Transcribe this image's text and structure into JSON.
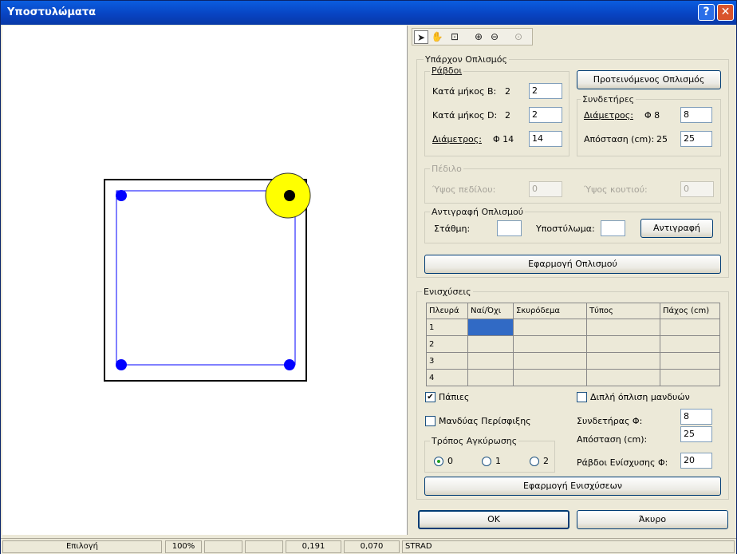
{
  "window": {
    "title": "Υποστυλώματα"
  },
  "toolbar": {
    "tools": [
      "pointer-icon",
      "hand-pan-icon",
      "zoom-window-icon",
      "zoom-in-icon",
      "zoom-out-icon",
      "zoom-extents-icon"
    ]
  },
  "existing": {
    "legend": "Υπάρχον Οπλισμός",
    "bars": {
      "legend": "Ράβδοι",
      "len_b_label": "Κατά μήκος B:",
      "len_b_value": "2",
      "len_b_input": "2",
      "len_d_label": "Κατά μήκος D:",
      "len_d_value": "2",
      "len_d_input": "2",
      "diam_label": "Διάμετρος:",
      "diam_value": "Φ 14",
      "diam_input": "14"
    },
    "suggested_button": "Προτεινόμενος Οπλισμός",
    "stirrups": {
      "legend": "Συνδετήρες",
      "diam_label": "Διάμετρος:",
      "diam_value": "Φ 8",
      "diam_input": "8",
      "spacing_label": "Απόσταση (cm):",
      "spacing_value": "25",
      "spacing_input": "25"
    },
    "footing": {
      "legend": "Πέδιλο",
      "height_label": "Ύψος πεδίλου:",
      "height_input": "0",
      "box_label": "Ύψος κουτιού:",
      "box_input": "0"
    },
    "copy": {
      "legend": "Αντιγραφή Οπλισμού",
      "level_label": "Στάθμη:",
      "level_input": "",
      "column_label": "Υποστύλωμα:",
      "column_input": "",
      "copy_button": "Αντιγραφή"
    },
    "apply_button": "Εφαρμογή Οπλισμού"
  },
  "reinforcement": {
    "legend": "Ενισχύσεις",
    "columns": [
      "Πλευρά",
      "Ναί/Όχι",
      "Σκυρόδεμα",
      "Τύπος",
      "Πάχος (cm)"
    ],
    "rows": [
      "1",
      "2",
      "3",
      "4"
    ],
    "flanges_label": "Πάπιες",
    "double_label": "Διπλή όπλιση μανδυών",
    "jacket_label": "Μανδύας Περίσφιξης",
    "stirrup_label": "Συνδετήρας Φ:",
    "stirrup_input": "8",
    "spacing_label": "Απόσταση (cm):",
    "spacing_input": "25",
    "bars_label": "Ράβδοι Ενίσχυσης Φ:",
    "bars_input": "20",
    "anchorage": {
      "legend": "Τρόπος Αγκύρωσης",
      "options": [
        "0",
        "1",
        "2"
      ],
      "selected": "0"
    },
    "apply_button": "Εφαρμογή Ενισχύσεων"
  },
  "dialog": {
    "ok_button": "OK",
    "cancel_button": "Άκυρο"
  },
  "status": {
    "mode": "Επιλογή",
    "zoom": "100%",
    "x": "0,191",
    "y": "0,070",
    "app": "STRAD"
  },
  "colors": {
    "rebar": "#0000ff",
    "selected_rebar": "#000000",
    "highlight": "#ffff00",
    "grid_selected": "#316ac5"
  }
}
